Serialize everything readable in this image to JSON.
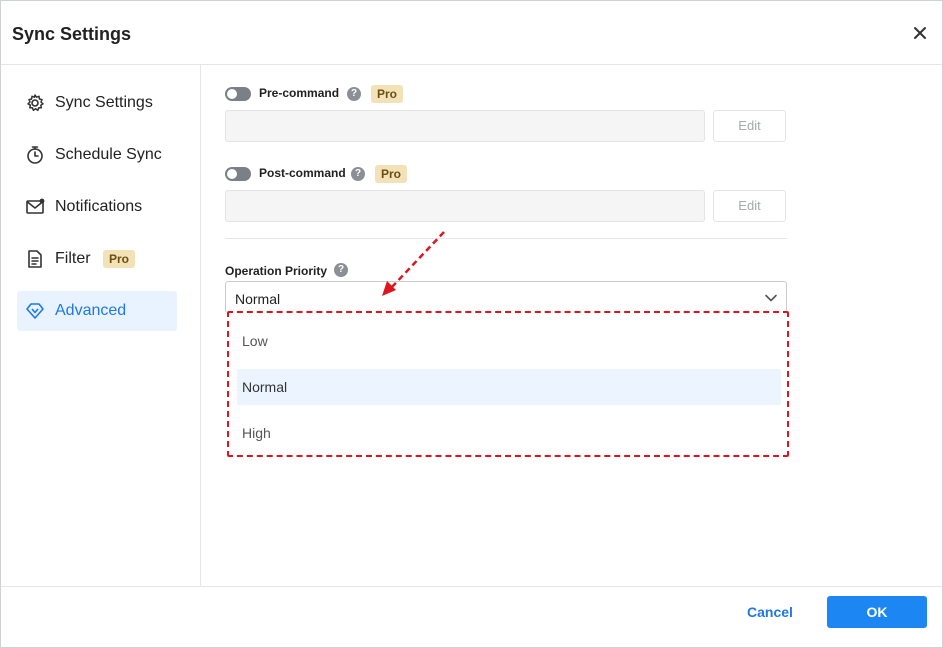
{
  "window": {
    "title": "Sync Settings",
    "close_icon": "close-icon"
  },
  "sidebar": {
    "items": [
      {
        "label": "Sync Settings",
        "icon": "gear-icon"
      },
      {
        "label": "Schedule Sync",
        "icon": "timer-icon"
      },
      {
        "label": "Notifications",
        "icon": "envelope-icon"
      },
      {
        "label": "Filter",
        "icon": "document-filter-icon",
        "badge": "Pro"
      },
      {
        "label": "Advanced",
        "icon": "diamond-icon",
        "active": true
      }
    ]
  },
  "advanced": {
    "pre_command": {
      "label": "Pre-command",
      "badge": "Pro",
      "value": "",
      "edit_label": "Edit",
      "enabled": false
    },
    "post_command": {
      "label": "Post-command",
      "badge": "Pro",
      "value": "",
      "edit_label": "Edit",
      "enabled": false
    },
    "priority": {
      "label": "Operation Priority",
      "selected": "Normal",
      "options": [
        "Low",
        "Normal",
        "High"
      ]
    }
  },
  "help_glyph": "?",
  "footer": {
    "cancel_label": "Cancel",
    "ok_label": "OK"
  },
  "colors": {
    "accent": "#1c86f2",
    "annotation": "#e0141e",
    "pro_badge_bg": "#f3e2b8"
  }
}
